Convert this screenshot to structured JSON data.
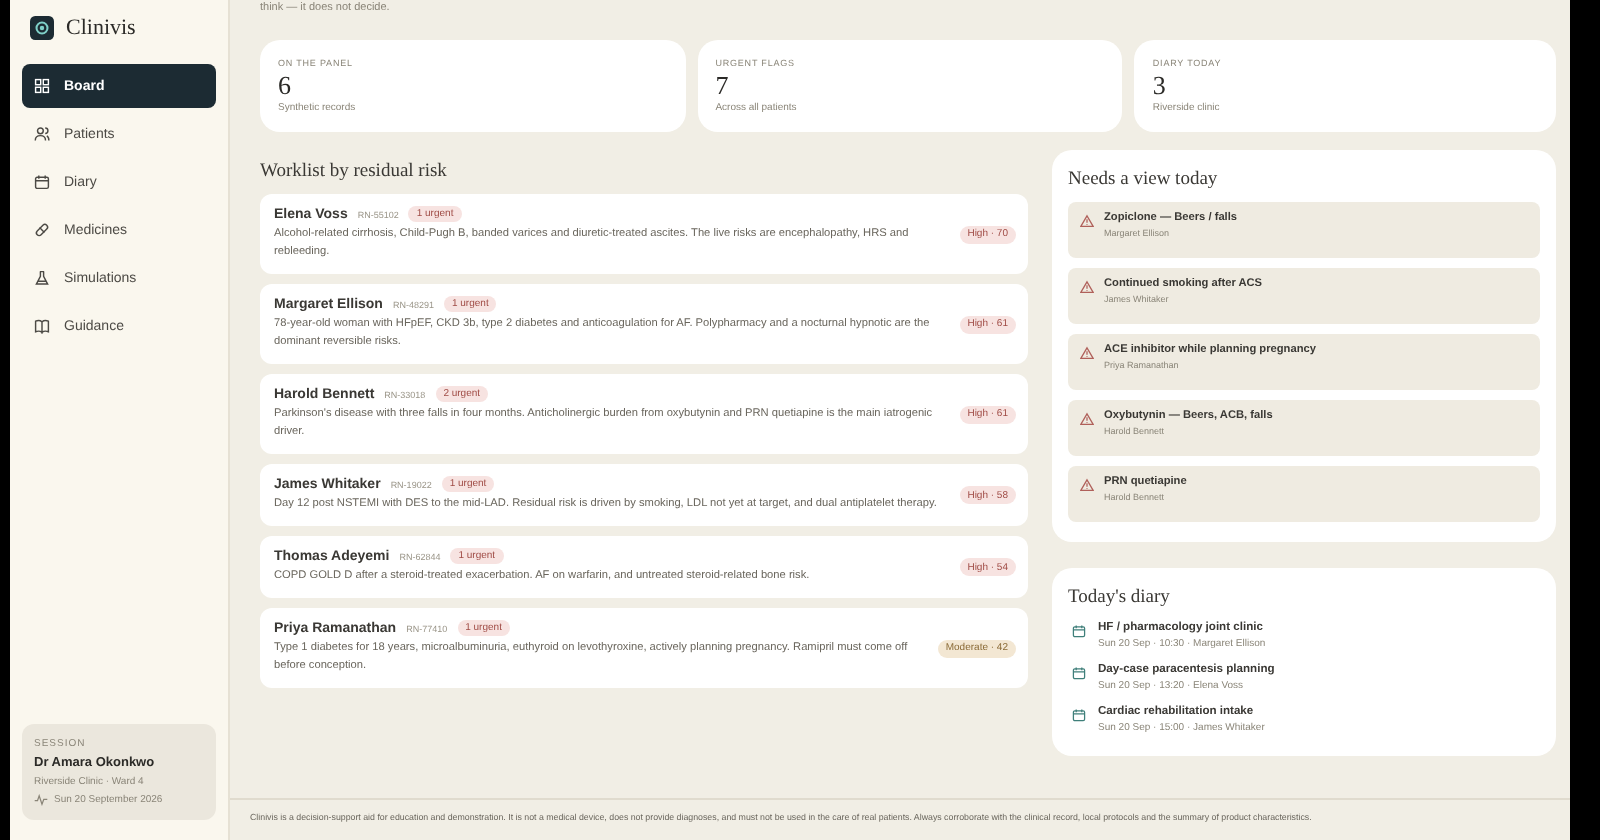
{
  "brand": {
    "name": "Clinivis"
  },
  "nav": [
    {
      "label": "Board",
      "selected": true
    },
    {
      "label": "Patients",
      "selected": false
    },
    {
      "label": "Diary",
      "selected": false
    },
    {
      "label": "Medicines",
      "selected": false
    },
    {
      "label": "Simulations",
      "selected": false
    },
    {
      "label": "Guidance",
      "selected": false
    }
  ],
  "session": {
    "heading": "SESSION",
    "user": "Dr Amara Okonkwo",
    "place": "Riverside Clinic · Ward 4",
    "date": "Sun 20 September 2026"
  },
  "intro": "think — it does not decide.",
  "stats": [
    {
      "label": "ON THE PANEL",
      "value": "6",
      "note": "Synthetic records"
    },
    {
      "label": "URGENT FLAGS",
      "value": "7",
      "note": "Across all patients"
    },
    {
      "label": "DIARY TODAY",
      "value": "3",
      "note": "Riverside clinic"
    }
  ],
  "worklist": {
    "title": "Worklist by residual risk",
    "rows": [
      {
        "name": "Elena Voss",
        "id": "RN-55102",
        "urgent": "1 urgent",
        "summary": "Alcohol-related cirrhosis, Child-Pugh B, banded varices and diuretic-treated ascites. The live risks are encephalopathy, HRS and rebleeding.",
        "risk": "High · 70",
        "kind": "high"
      },
      {
        "name": "Margaret Ellison",
        "id": "RN-48291",
        "urgent": "1 urgent",
        "summary": "78-year-old woman with HFpEF, CKD 3b, type 2 diabetes and anticoagulation for AF. Polypharmacy and a nocturnal hypnotic are the dominant reversible risks.",
        "risk": "High · 61",
        "kind": "high"
      },
      {
        "name": "Harold Bennett",
        "id": "RN-33018",
        "urgent": "2 urgent",
        "summary": "Parkinson's disease with three falls in four months. Anticholinergic burden from oxybutynin and PRN quetiapine is the main iatrogenic driver.",
        "risk": "High · 61",
        "kind": "high"
      },
      {
        "name": "James Whitaker",
        "id": "RN-19022",
        "urgent": "1 urgent",
        "summary": "Day 12 post NSTEMI with DES to the mid-LAD. Residual risk is driven by smoking, LDL not yet at target, and dual antiplatelet therapy.",
        "risk": "High · 58",
        "kind": "high"
      },
      {
        "name": "Thomas Adeyemi",
        "id": "RN-62844",
        "urgent": "1 urgent",
        "summary": "COPD GOLD D after a steroid-treated exacerbation. AF on warfarin, and untreated steroid-related bone risk.",
        "risk": "High · 54",
        "kind": "high"
      },
      {
        "name": "Priya Ramanathan",
        "id": "RN-77410",
        "urgent": "1 urgent",
        "summary": "Type 1 diabetes for 18 years, microalbuminuria, euthyroid on levothyroxine, actively planning pregnancy. Ramipril must come off before conception.",
        "risk": "Moderate · 42",
        "kind": "moderate"
      }
    ]
  },
  "flags": {
    "title": "Needs a view today",
    "items": [
      {
        "title": "Zopiclone — Beers / falls",
        "patient": "Margaret Ellison"
      },
      {
        "title": "Continued smoking after ACS",
        "patient": "James Whitaker"
      },
      {
        "title": "ACE inhibitor while planning pregnancy",
        "patient": "Priya Ramanathan"
      },
      {
        "title": "Oxybutynin — Beers, ACB, falls",
        "patient": "Harold Bennett"
      },
      {
        "title": "PRN quetiapine",
        "patient": "Harold Bennett"
      }
    ]
  },
  "diary": {
    "title": "Today's diary",
    "items": [
      {
        "title": "HF / pharmacology joint clinic",
        "detail": "Sun 20 Sep · 10:30 · Margaret Ellison"
      },
      {
        "title": "Day-case paracentesis planning",
        "detail": "Sun 20 Sep · 13:20 · Elena Voss"
      },
      {
        "title": "Cardiac rehabilitation intake",
        "detail": "Sun 20 Sep · 15:00 · James Whitaker"
      }
    ]
  },
  "footer": "Clinivis is a decision-support aid for education and demonstration. It is not a medical device, does not provide diagnoses, and must not be used in the care of real patients. Always corroborate with the clinical record, local protocols and the summary of product characteristics."
}
